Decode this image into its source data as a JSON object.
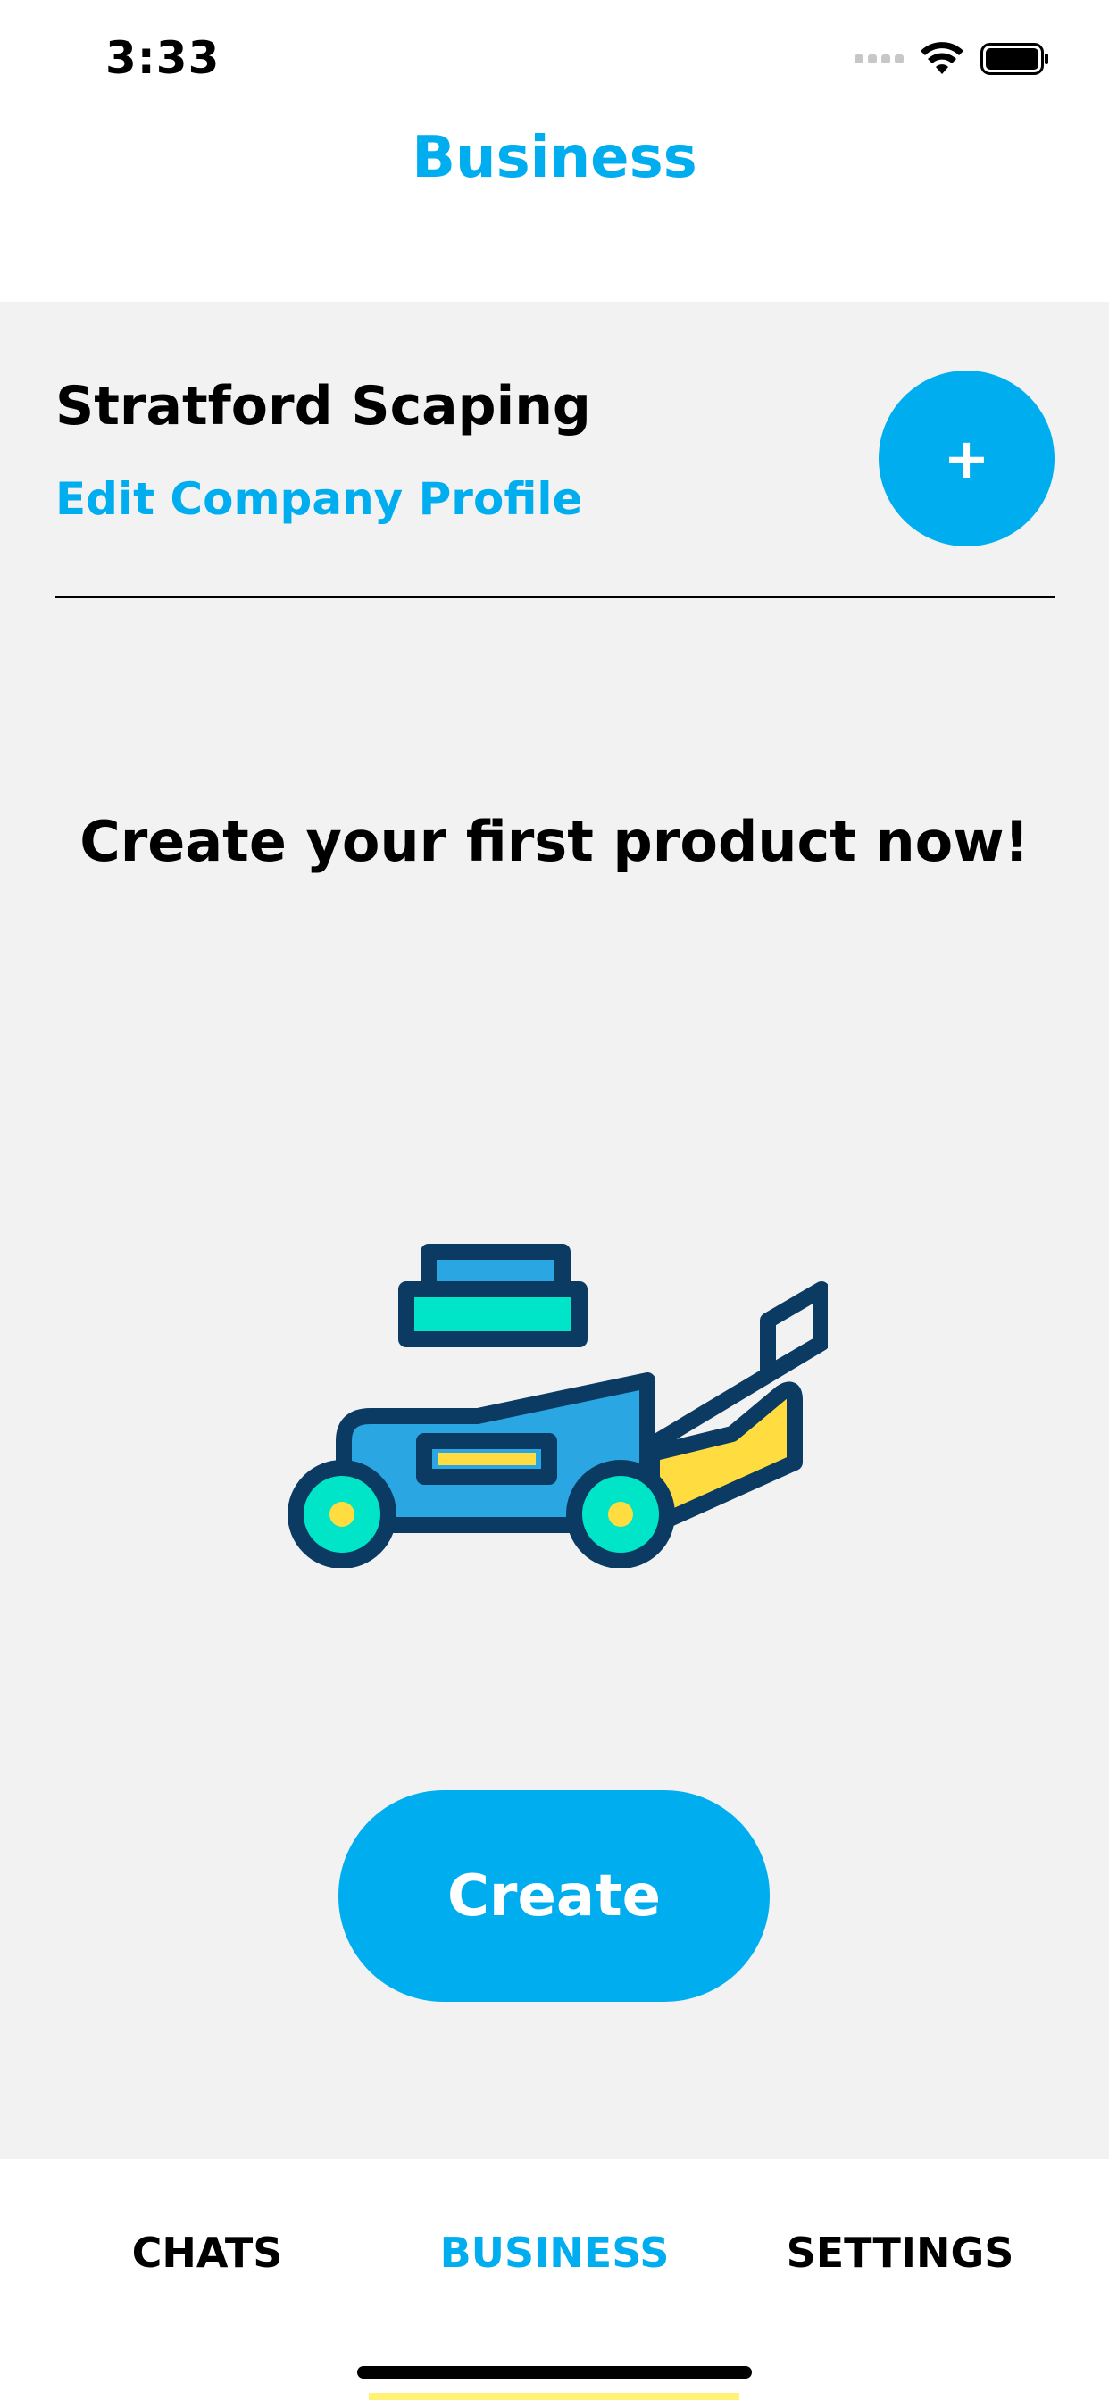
{
  "status_bar": {
    "time": "3:33",
    "icons": [
      "signal-dots",
      "wifi-icon",
      "battery-icon"
    ]
  },
  "header": {
    "title": "Business"
  },
  "company": {
    "name": "Stratford Scaping",
    "edit_label": "Edit Company Profile",
    "add_label": "+"
  },
  "empty_state": {
    "prompt": "Create your first product now!",
    "illustration": "lawn-mower-icon",
    "create_label": "Create"
  },
  "tabs": [
    {
      "label": "CHATS",
      "active": false
    },
    {
      "label": "BUSINESS",
      "active": true
    },
    {
      "label": "SETTINGS",
      "active": false
    }
  ],
  "colors": {
    "accent": "#00adef",
    "background": "#f2f2f2",
    "mower_outline": "#0b3a63",
    "mower_body": "#2aa7e3",
    "mower_engine": "#00e5c8",
    "mower_bag": "#ffdc3f",
    "highlight_strip": "#fff275"
  }
}
